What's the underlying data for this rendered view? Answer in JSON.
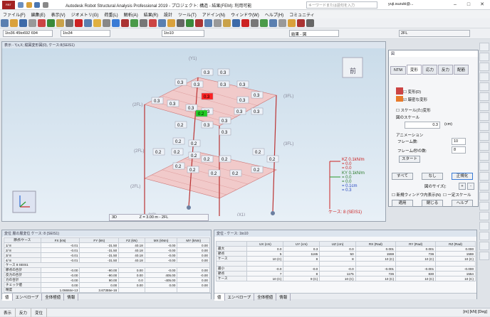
{
  "app": {
    "title": "Autodesk Robot Structural Analysis Professional 2019 - プロジェクト: 構造 - 結果(FEM): 利用可能",
    "search_placeholder": "キーワードまたは語句を入力",
    "user": "yuji.suzuki@...",
    "logo_text": "RBT"
  },
  "menu": [
    "ファイル(F)",
    "編集(E)",
    "表示(V)",
    "ジオメトリ(G)",
    "荷重(L)",
    "解析(A)",
    "結果(R)",
    "設計",
    "ツール(T)",
    "アドイン(N)",
    "ウィンドウ(W)",
    "ヘルプ(H)",
    "コミュニティ"
  ],
  "toolbar": {
    "combo_selection": "1to36 45to692 694",
    "combo_cases": "1to34",
    "combo_story": "1to10",
    "combo_results": "結果 - 図"
  },
  "view": {
    "title": "表示 - Y,x,X; 縦図変形図(0), ケース:8(SEIS1)",
    "mode": "3D",
    "elevation": "Z = 3.00 m - 2FL",
    "case_label": "ケース: 8 (SEIS1)",
    "front_label": "前",
    "story_labels": [
      "2FL",
      "3FL",
      "2FL",
      "3FL",
      "2FL",
      "1FL",
      "(Y1)",
      "(X1)",
      "(X2)",
      "(Y2)",
      "(Y3)"
    ],
    "upper_values": [
      "0.3",
      "0.3",
      "0.3",
      "0.3",
      "0.3",
      "0.3",
      "0.3",
      "0.3",
      "0.3",
      "0.3",
      "0.3",
      "0.3",
      "0.3",
      "0.3",
      "0.3",
      "0.2",
      "0.3",
      "0.3"
    ],
    "lower_values": [
      "0.2",
      "0.2",
      "0.2",
      "0.2",
      "0.2",
      "0.2",
      "0.2",
      "0.2",
      "0.2",
      "0.2",
      "0.2",
      "0.2",
      "0.2",
      "0.2"
    ],
    "highlight_red": "0.3",
    "highlight_green": "0.2",
    "legend": [
      "KZ  0.1kN/m",
      "=  0.0",
      "=  0.0",
      "KY  0.1kN/m",
      "=  0.0",
      "=  0.0",
      "=  0.1cm",
      "=  0.3"
    ]
  },
  "dialog": {
    "title": "図",
    "tabs": [
      "NTM",
      "変形",
      "応力",
      "反力",
      "配筋"
    ],
    "chk_deform": "変形(D)",
    "chk_exact": "厳密な変形",
    "chk_scaled": "スケール(た)変形",
    "scale_label": "図のスケール",
    "scale_value": "0.3",
    "scale_unit": "(cm)",
    "anim_label": "アニメーション",
    "frames_label": "フレーム数:",
    "frames_value": "10",
    "fps_label": "フレーム/秒の数:",
    "fps_value": "8",
    "start_btn": "スタート",
    "all_btn": "すべて",
    "none_btn": "なし",
    "normalize_btn": "正規化",
    "size_label": "図のサイズ(:",
    "new_window_chk": "新規ウィンドウ内表示(N)",
    "const_scale_chk": "一定スケール",
    "apply_btn": "適用",
    "close_btn": "閉じる",
    "help_btn": "ヘルプ"
  },
  "story_panel": {
    "title": "変位 層の層変位 ケース: 8 (SEIS1)",
    "headers": [
      "節点/ケース",
      "FX (kN)",
      "FY (kN)",
      "FZ (kN)",
      "MX (kNm)",
      "MY (kNm)"
    ],
    "rows": [
      [
        "1/  8",
        "-0.01",
        "-31.50",
        "40.18",
        "-0.00",
        "0.00"
      ],
      [
        "2/  8",
        "-0.01",
        "-31.50",
        "40.18",
        "-0.00",
        "0.00"
      ],
      [
        "3/  8",
        "-0.01",
        "-31.50",
        "40.18",
        "-0.00",
        "0.00"
      ],
      [
        "4/  8",
        "-0.01",
        "-31.50",
        "40.18",
        "-0.00",
        "0.00"
      ]
    ],
    "case_row": "ケース 8    SEIS1",
    "sum_rows": [
      [
        "節点の合計",
        "-0.00",
        "-90.00",
        "0.00",
        "-0.00",
        "0.00"
      ],
      [
        "反力の合計",
        "-0.00",
        "-90.00",
        "0.00",
        "405.00",
        "-0.00"
      ],
      [
        "力の合計",
        "-0.00",
        "90.00",
        "0.0",
        "-405.00",
        "0.00"
      ],
      [
        "チェック値",
        "0.00",
        "0.00",
        "0.00",
        "0.00",
        "0.00"
      ],
      [
        "精度",
        "1.06684e-13",
        "3.67355e-16",
        "",
        "",
        ""
      ]
    ],
    "tabs": [
      "値",
      "エンベロープ",
      "全体極値",
      "情報"
    ]
  },
  "disp_panel": {
    "title": "変位 - ケース: 1to10",
    "headers": [
      "",
      "UX (cm)",
      "UY (cm)",
      "UZ (cm)",
      "RX (Rad)",
      "RY (Rad)",
      "RZ (Rad)"
    ],
    "rows": [
      [
        "最大",
        "0.0",
        "0.3",
        "0.0",
        "0.001",
        "0.001",
        "0.000"
      ],
      [
        "節点",
        "5",
        "1165",
        "50",
        "1559",
        "736",
        "1559"
      ],
      [
        "ケース",
        "10 (C)",
        "8",
        "8",
        "10 (C)",
        "10 (C)",
        "10 (C)"
      ],
      [
        "",
        "",
        "",
        "",
        "",
        "",
        ""
      ],
      [
        "最小",
        "-0.0",
        "-0.0",
        "-0.0",
        "-0.001",
        "-0.001",
        "-0.000"
      ],
      [
        "節点",
        "7",
        "8",
        "1175",
        "726",
        "830",
        "1554"
      ],
      [
        "ケース",
        "10 (C)",
        "9 (C)",
        "10 (C)",
        "10 (C)",
        "10 (C)",
        "10 (C)"
      ]
    ],
    "tabs": [
      "値",
      "エンベロープ",
      "全体極値",
      "情報"
    ]
  },
  "status": {
    "left": [
      "表示",
      "反力",
      "変位"
    ],
    "units": "[m] [kN] [Deg]"
  },
  "colors": {
    "accent_red": "#ff2222",
    "accent_green": "#22cc22",
    "slab": "#e8a0a0"
  }
}
